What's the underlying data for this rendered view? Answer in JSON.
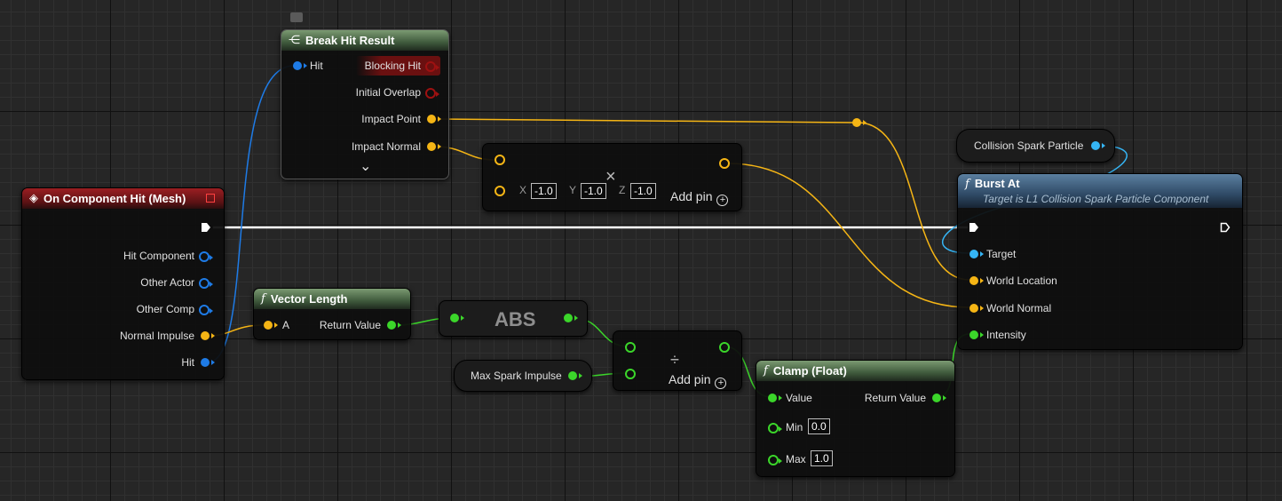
{
  "colors": {
    "exec": "#ffffff",
    "object": "#1e7be6",
    "struct": "#f5b515",
    "float": "#3bd62a",
    "component": "#35b5f5",
    "bool": "#9e1111"
  },
  "break_hit": {
    "title": "Break Hit Result",
    "icon": "break-struct-icon",
    "hit": "Hit",
    "blocking": "Blocking Hit",
    "initial_overlap": "Initial Overlap",
    "impact_point": "Impact Point",
    "impact_normal": "Impact Normal",
    "expand": "⌄"
  },
  "event": {
    "title": "On Component Hit (Mesh)",
    "icon": "event-diamond-icon",
    "hit_component": "Hit Component",
    "other_actor": "Other Actor",
    "other_comp": "Other Comp",
    "normal_impulse": "Normal Impulse",
    "hit": "Hit"
  },
  "multiply": {
    "symbol": "×",
    "x_label": "X",
    "x": "-1.0",
    "y_label": "Y",
    "y": "-1.0",
    "z_label": "Z",
    "z": "-1.0",
    "add_pin": "Add pin"
  },
  "vector_length": {
    "title": "Vector Length",
    "a": "A",
    "return": "Return Value"
  },
  "abs": {
    "title": "ABS"
  },
  "max_spark": {
    "label": "Max Spark Impulse"
  },
  "divide": {
    "symbol": "÷",
    "add_pin": "Add pin"
  },
  "clamp": {
    "title": "Clamp (Float)",
    "value": "Value",
    "return": "Return Value",
    "min": "Min",
    "min_val": "0.0",
    "max": "Max",
    "max_val": "1.0"
  },
  "spark_var": {
    "label": "Collision Spark Particle"
  },
  "burst": {
    "title": "Burst At",
    "subtitle": "Target is L1 Collision Spark Particle Component",
    "target": "Target",
    "world_location": "World Location",
    "world_normal": "World Normal",
    "intensity": "Intensity"
  }
}
